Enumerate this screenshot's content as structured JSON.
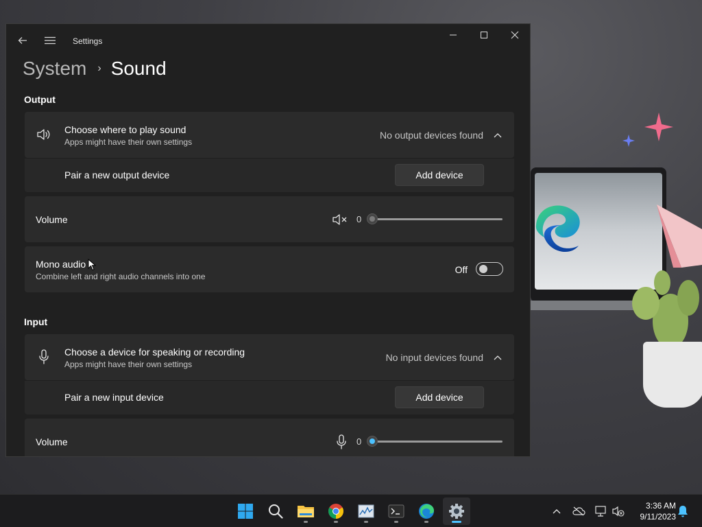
{
  "window": {
    "app_title": "Settings",
    "breadcrumb": {
      "parent": "System",
      "separator": "›",
      "current": "Sound"
    }
  },
  "output": {
    "section_title": "Output",
    "choose": {
      "title": "Choose where to play sound",
      "subtitle": "Apps might have their own settings",
      "status": "No output devices found",
      "icon": "speaker-icon"
    },
    "pair": {
      "label": "Pair a new output device",
      "button": "Add device"
    },
    "volume": {
      "label": "Volume",
      "value": "0",
      "level": 0,
      "icon": "speaker-muted-icon"
    },
    "mono": {
      "title": "Mono audio",
      "subtitle": "Combine left and right audio channels into one",
      "state": "Off",
      "on": false
    }
  },
  "input": {
    "section_title": "Input",
    "choose": {
      "title": "Choose a device for speaking or recording",
      "subtitle": "Apps might have their own settings",
      "status": "No input devices found",
      "icon": "microphone-icon"
    },
    "pair": {
      "label": "Pair a new input device",
      "button": "Add device"
    },
    "volume": {
      "label": "Volume",
      "value": "0",
      "level": 0,
      "icon": "microphone-icon"
    }
  },
  "taskbar": {
    "apps": [
      "start-button",
      "search",
      "file-explorer",
      "chrome",
      "resource-monitor",
      "terminal",
      "edge",
      "settings"
    ],
    "active_app": "settings",
    "clock": {
      "time": "3:36 AM",
      "date": "9/11/2023"
    }
  },
  "colors": {
    "accent": "#4cc2ff",
    "window_bg": "#202020",
    "card_bg": "#2b2b2b",
    "taskbar_bg": "#1c1c1e"
  }
}
